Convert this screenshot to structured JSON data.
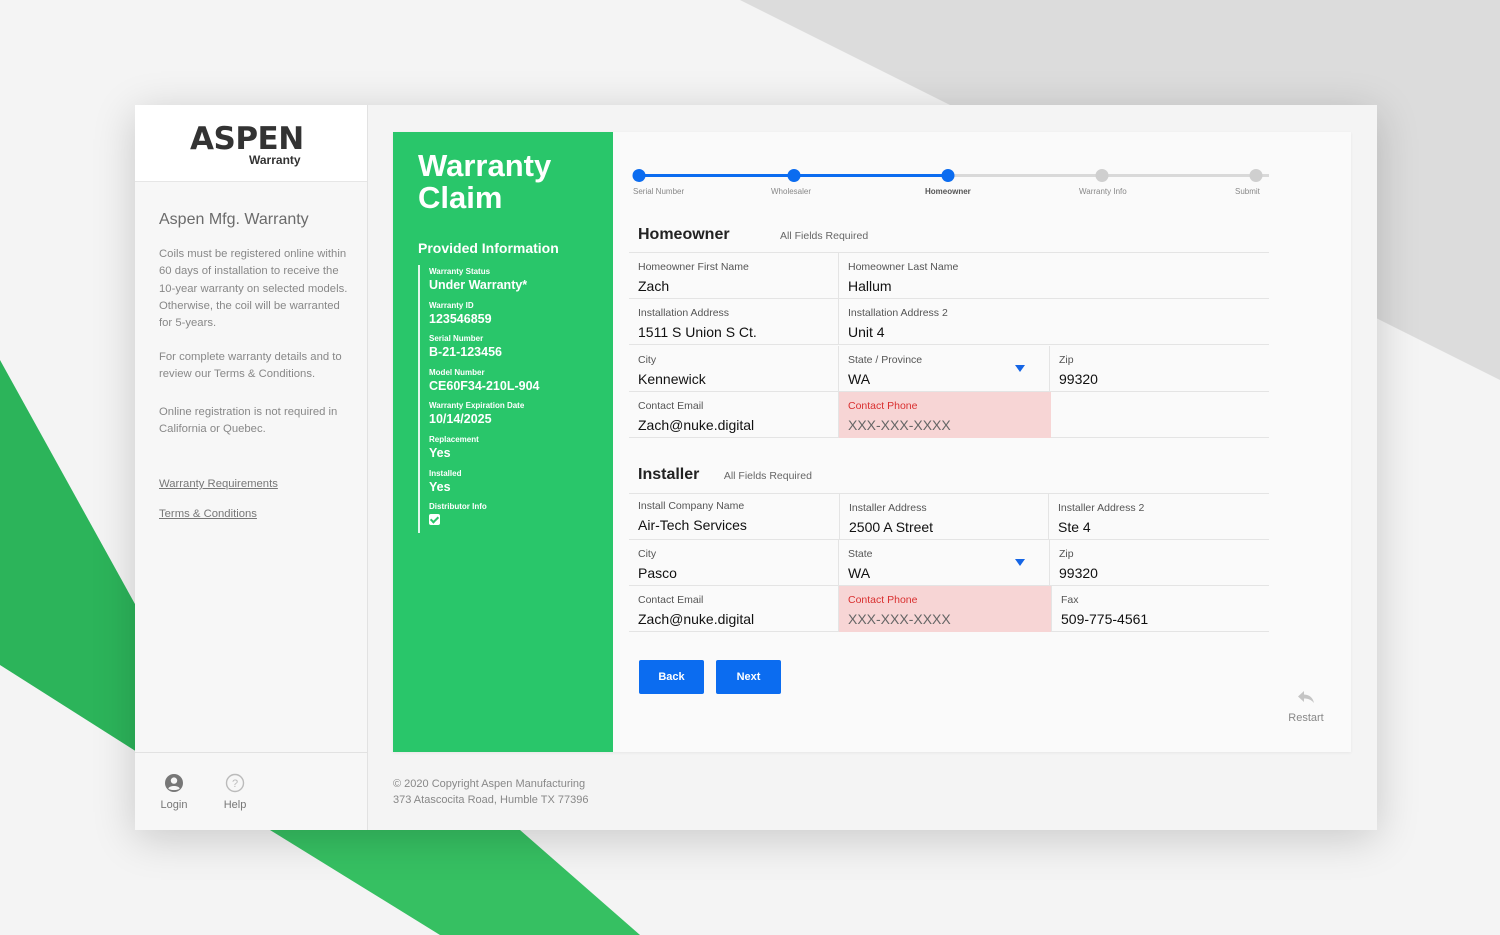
{
  "colors": {
    "accent_green": "#29c66a",
    "primary_blue": "#0b6cf0",
    "error_bg": "#f7d5d5"
  },
  "sidebar": {
    "logo_main": "ASPEN",
    "logo_sub": "Warranty",
    "title": "Aspen Mfg. Warranty",
    "paragraphs": [
      "Coils must be registered online within 60 days of installation to receive the 10-year warranty on selected models. Otherwise, the coil will be warranted for 5-years.",
      "For complete warranty details and to review our Terms & Conditions.",
      "Online registration is not required in California or Quebec."
    ],
    "links": [
      "Warranty Requirements",
      "Terms & Conditions"
    ],
    "bottom": {
      "login_label": "Login",
      "help_label": "Help",
      "login_icon": "user-circle-icon",
      "help_icon": "help-circle-icon"
    }
  },
  "panel": {
    "title": "Warranty Claim",
    "subtitle": "Provided Information",
    "items": [
      {
        "label": "Warranty Status",
        "value": "Under Warranty*"
      },
      {
        "label": "Warranty ID",
        "value": "123546859"
      },
      {
        "label": "Serial Number",
        "value": "B-21-123456"
      },
      {
        "label": "Model Number",
        "value": "CE60F34-210L-904"
      },
      {
        "label": "Warranty Expiration Date",
        "value": "10/14/2025"
      },
      {
        "label": "Replacement",
        "value": "Yes"
      },
      {
        "label": "Installed",
        "value": "Yes"
      },
      {
        "label": "Distributor Info",
        "checked": true
      }
    ]
  },
  "stepper": {
    "steps": [
      "Serial Number",
      "Wholesaler",
      "Homeowner",
      "Warranty Info",
      "Submit"
    ],
    "current_step": 3
  },
  "homeowner": {
    "title": "Homeowner",
    "note": "All Fields Required",
    "first_name": {
      "label": "Homeowner First Name",
      "value": "Zach"
    },
    "last_name": {
      "label": "Homeowner Last Name",
      "value": "Hallum"
    },
    "address": {
      "label": "Installation Address",
      "value": "1511 S Union S Ct."
    },
    "address2": {
      "label": "Installation Address 2",
      "value": "Unit 4"
    },
    "city": {
      "label": "City",
      "value": "Kennewick"
    },
    "state": {
      "label": "State / Province",
      "value": "WA"
    },
    "zip": {
      "label": "Zip",
      "value": "99320"
    },
    "email": {
      "label": "Contact Email",
      "value": "Zach@nuke.digital"
    },
    "phone": {
      "label": "Contact Phone",
      "placeholder": "XXX-XXX-XXXX"
    }
  },
  "installer": {
    "title": "Installer",
    "note": "All Fields Required",
    "company": {
      "label": "Install Company Name",
      "value": "Air-Tech Services"
    },
    "address": {
      "label": "Installer Address",
      "value": "2500 A Street"
    },
    "address2": {
      "label": "Installer Address 2",
      "value": "Ste 4"
    },
    "city": {
      "label": "City",
      "value": "Pasco"
    },
    "state": {
      "label": "State",
      "value": "WA"
    },
    "zip": {
      "label": "Zip",
      "value": "99320"
    },
    "email": {
      "label": "Contact Email",
      "value": "Zach@nuke.digital"
    },
    "phone": {
      "label": "Contact Phone",
      "placeholder": "XXX-XXX-XXXX"
    },
    "fax": {
      "label": "Fax",
      "value": "509-775-4561"
    }
  },
  "actions": {
    "back_label": "Back",
    "next_label": "Next",
    "restart_label": "Restart",
    "restart_icon": "reply-arrow-icon"
  },
  "footer": {
    "copyright": "© 2020 Copyright Aspen Manufacturing",
    "address": "373 Atascocita Road, Humble TX 77396"
  }
}
